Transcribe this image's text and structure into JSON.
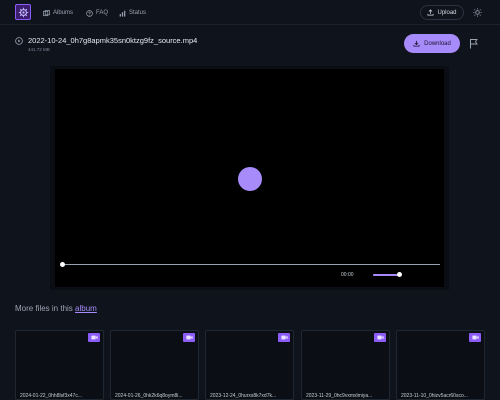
{
  "header": {
    "nav": [
      {
        "label": "Albums",
        "icon": "albums-icon"
      },
      {
        "label": "FAQ",
        "icon": "help-icon"
      },
      {
        "label": "Status",
        "icon": "status-icon"
      }
    ],
    "upload_label": "Upload"
  },
  "file": {
    "name": "2022-10-24_0h7g8apmk35sn0ktzg9fz_source.mp4",
    "size": "441.72 MB",
    "download_label": "Download"
  },
  "player": {
    "time": "00:00",
    "progress": 0,
    "volume": 1.0
  },
  "more": {
    "prefix": "More files in this ",
    "link": "album"
  },
  "thumbnails": [
    {
      "caption": "2024-01-22_0hh8lsf3x47c..."
    },
    {
      "caption": "2024-01-26_0hk2k6q8oym8i..."
    },
    {
      "caption": "2023-12-24_0hurxs8k7xd7k..."
    },
    {
      "caption": "2023-11-29_0hc9vxmxlmiya..."
    },
    {
      "caption": "2023-11-10_0hizv5acr60sco..."
    }
  ],
  "colors": {
    "accent": "#a78bfa",
    "background": "#0f141c",
    "player": "#000000"
  }
}
